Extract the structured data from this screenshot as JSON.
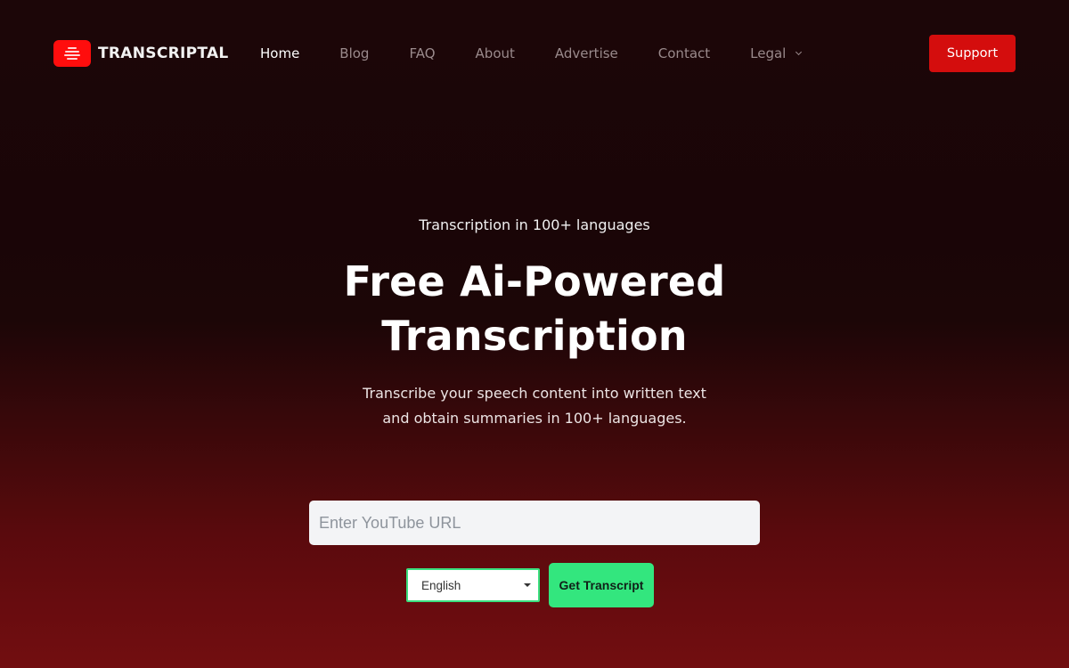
{
  "brand": {
    "name": "TRANSCRIPTAL",
    "logo_icon": "stacked-lines-icon"
  },
  "nav": {
    "items": [
      {
        "label": "Home",
        "active": true
      },
      {
        "label": "Blog",
        "active": false
      },
      {
        "label": "FAQ",
        "active": false
      },
      {
        "label": "About",
        "active": false
      },
      {
        "label": "Advertise",
        "active": false
      },
      {
        "label": "Contact",
        "active": false
      },
      {
        "label": "Legal",
        "active": false,
        "has_dropdown": true,
        "icon": "chevron-down-icon"
      }
    ],
    "support_label": "Support"
  },
  "hero": {
    "eyebrow": "Transcription in 100+ languages",
    "title_line1": "Free Ai-Powered",
    "title_line2": "Transcription",
    "subtitle": "Transcribe your speech content into written text and obtain summaries in 100+ languages."
  },
  "form": {
    "url_placeholder": "Enter YouTube URL",
    "url_value": "",
    "language_selected": "English",
    "submit_label": "Get Transcript"
  },
  "colors": {
    "brand_red": "#ff0d0d",
    "support_button": "#d40d0d",
    "cta_green": "#33e67e",
    "select_border": "#3be07f",
    "background_top": "#1a0507",
    "background_bottom": "#720e10"
  }
}
